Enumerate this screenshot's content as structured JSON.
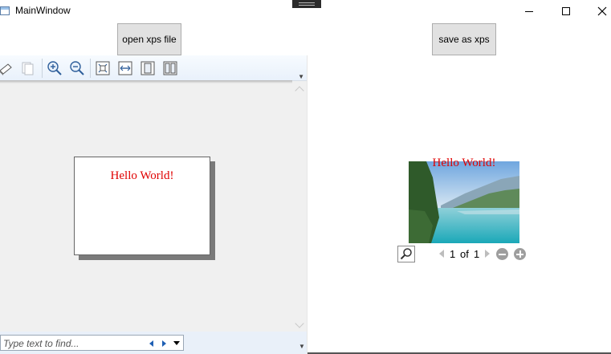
{
  "window": {
    "title": "MainWindow"
  },
  "buttons": {
    "open_label": "open xps file",
    "save_label": "save as xps"
  },
  "viewer": {
    "toolbar_icons": [
      "print-icon",
      "copy-icon",
      "zoom-in-icon",
      "zoom-out-icon",
      "actual-size-icon",
      "page-width-icon",
      "whole-page-icon",
      "two-pages-icon"
    ],
    "page_text": "Hello World!",
    "find_placeholder": "Type text to find..."
  },
  "preview": {
    "overlay_text": "Hello World!",
    "current_page": "1",
    "of_label": "of",
    "total_pages": "1"
  },
  "colors": {
    "accent_red": "#e00000",
    "button_face": "#e1e1e1",
    "toolbar_blue": "#e9f1fb",
    "find_nav_blue": "#1e5fb4"
  }
}
